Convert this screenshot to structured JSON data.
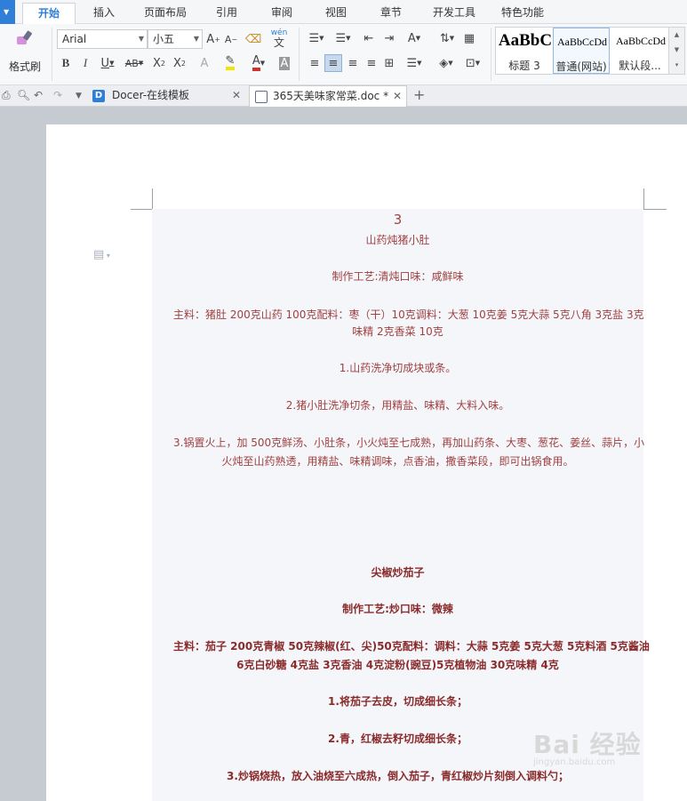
{
  "tabs": [
    "开始",
    "插入",
    "页面布局",
    "引用",
    "审阅",
    "视图",
    "章节",
    "开发工具",
    "特色功能"
  ],
  "ribbon": {
    "format_painter": "格式刷",
    "font_name": "Arial",
    "font_size": "小五",
    "pinyin": "wén",
    "styles": [
      {
        "sample": "AaBbC",
        "name": "标题 3"
      },
      {
        "sample": "AaBbCcDd",
        "name": "普通(网站)"
      },
      {
        "sample": "AaBbCcDd",
        "name": "默认段..."
      }
    ]
  },
  "doc_tabs": [
    {
      "title": "Docer-在线模板"
    },
    {
      "title": "365天美味家常菜.doc *"
    }
  ],
  "document": {
    "page_number": "3",
    "recipe1": {
      "title": "山药炖猪小肚",
      "technique": "制作工艺:清炖口味：咸鲜味",
      "ingredients_l1": "主料：猪肚 200克山药 100克配料：枣（干）10克调料：大葱 10克姜 5克大蒜 5克八角 3克盐 3克",
      "ingredients_l2": "味精 2克香菜 10克",
      "step1": "1.山药洗净切成块或条。",
      "step2": "2.猪小肚洗净切条，用精盐、味精、大料入味。",
      "step3_l1": "3.锅置火上，加 500克鲜汤、小肚条，小火炖至七成熟，再加山药条、大枣、葱花、姜丝、蒜片，小",
      "step3_l2": "火炖至山药熟透，用精盐、味精调味，点香油，撒香菜段，即可出锅食用。"
    },
    "recipe2": {
      "title": "尖椒炒茄子",
      "technique": "制作工艺:炒口味：微辣",
      "ingredients_l1": "主料：茄子 200克青椒 50克辣椒(红、尖)50克配料：调料：大蒜 5克姜 5克大葱 5克料酒 5克酱油",
      "ingredients_l2": "6克白砂糖 4克盐 3克香油 4克淀粉(豌豆)5克植物油 30克味精 4克",
      "step1": "1.将茄子去皮，切成细长条；",
      "step2": "2.青，红椒去籽切成细长条；",
      "step3": "3.炒锅烧热，放入油烧至六成热，倒入茄子，青红椒炒片刻倒入调料勺；"
    }
  },
  "watermark": {
    "text": "Bai 经验",
    "sub": "jingyan.baidu.com"
  }
}
